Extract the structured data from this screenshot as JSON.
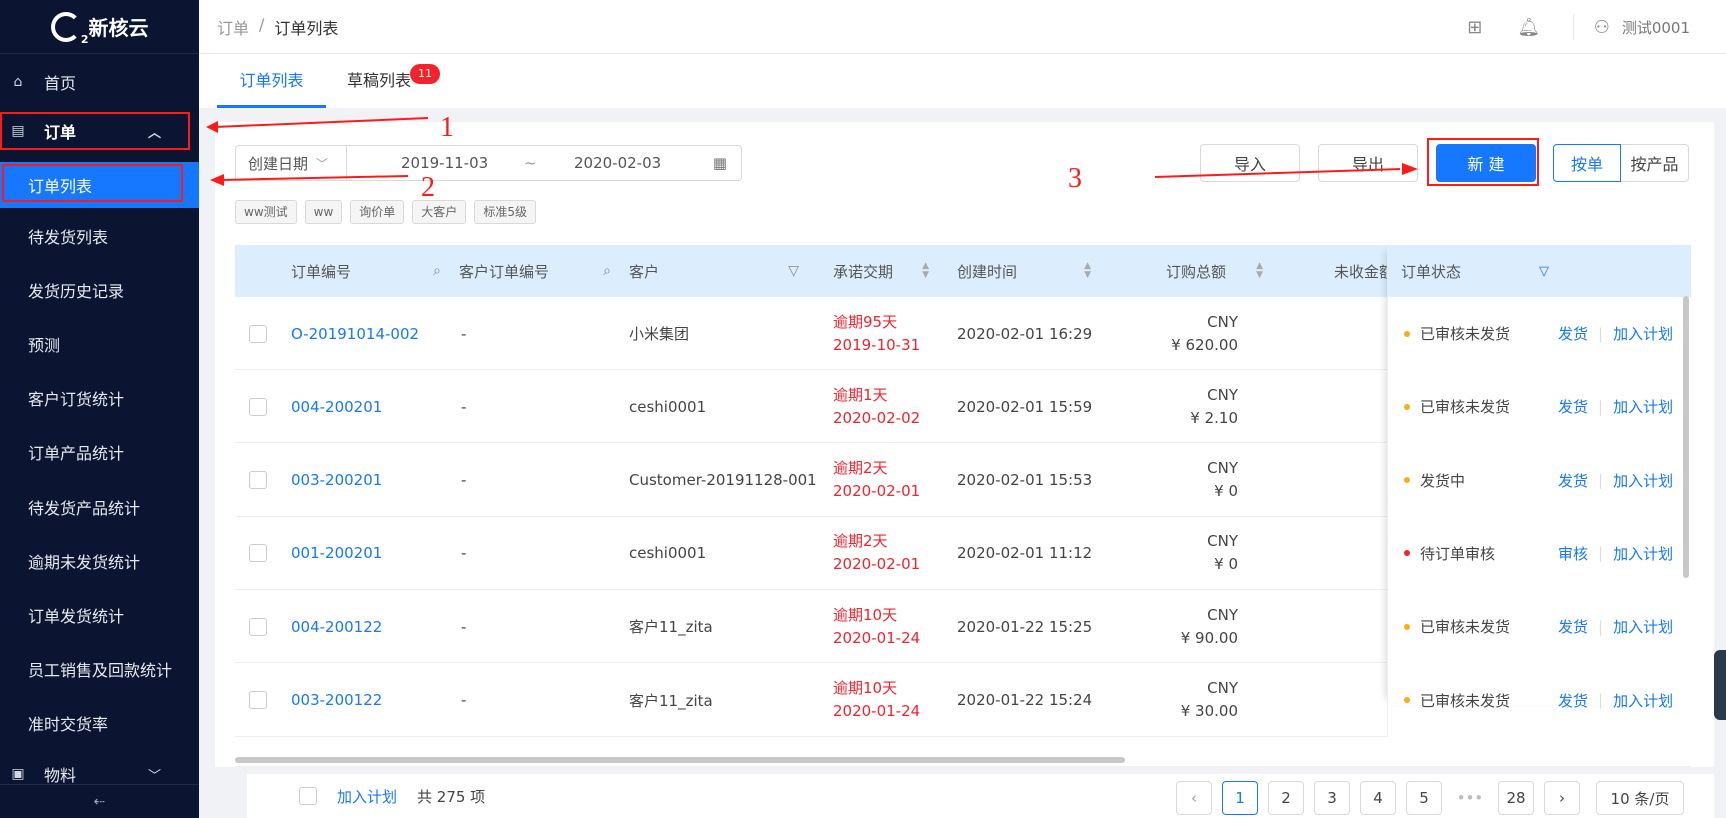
{
  "app": {
    "name": "新核云"
  },
  "sidebar": {
    "home": "首页",
    "order_group": "订单",
    "items": [
      {
        "label": "订单列表"
      },
      {
        "label": "待发货列表"
      },
      {
        "label": "发货历史记录"
      },
      {
        "label": "预测"
      },
      {
        "label": "客户订货统计"
      },
      {
        "label": "订单产品统计"
      },
      {
        "label": "待发货产品统计"
      },
      {
        "label": "逾期未发货统计"
      },
      {
        "label": "订单发货统计"
      },
      {
        "label": "员工销售及回款统计"
      },
      {
        "label": "准时交货率"
      }
    ],
    "material_group": "物料",
    "collapse": "⇠"
  },
  "header": {
    "breadcrumb": [
      "订单",
      "/",
      "订单列表"
    ],
    "user": "测试0001"
  },
  "tabs": [
    {
      "label": "订单列表"
    },
    {
      "label": "草稿列表",
      "badge": "11"
    }
  ],
  "filter": {
    "date_type": "创建日期",
    "start": "2019-11-03",
    "sep": "~",
    "end": "2020-02-03",
    "tags": [
      "ww测试",
      "ww",
      "询价单",
      "大客户",
      "标准5级"
    ]
  },
  "toolbar": {
    "import": "导入",
    "export": "导出",
    "create": "新 建",
    "by_order": "按单",
    "by_product": "按产品"
  },
  "table": {
    "headers": {
      "order_no": "订单编号",
      "customer_order_no": "客户订单编号",
      "customer": "客户",
      "promise_date": "承诺交期",
      "created": "创建时间",
      "total": "订购总额",
      "unreceived": "未收金额",
      "status": "订单状态"
    },
    "rows": [
      {
        "order_no": "O-20191014-002",
        "customer_order_no": "-",
        "customer": "小米集团",
        "overdue": "逾期95天",
        "promise_date": "2019-10-31",
        "created": "2020-02-01 16:29",
        "currency": "CNY",
        "amount": "¥ 620.00",
        "status": "已审核未发货",
        "status_color": "#faad14",
        "op1": "发货",
        "op2": "加入计划"
      },
      {
        "order_no": "004-200201",
        "customer_order_no": "-",
        "customer": "ceshi0001",
        "overdue": "逾期1天",
        "promise_date": "2020-02-02",
        "created": "2020-02-01 15:59",
        "currency": "CNY",
        "amount": "¥ 2.10",
        "status": "已审核未发货",
        "status_color": "#faad14",
        "op1": "发货",
        "op2": "加入计划"
      },
      {
        "order_no": "003-200201",
        "customer_order_no": "-",
        "customer": "Customer-20191128-001",
        "overdue": "逾期2天",
        "promise_date": "2020-02-01",
        "created": "2020-02-01 15:53",
        "currency": "CNY",
        "amount": "¥ 0",
        "status": "发货中",
        "status_color": "#faad14",
        "op1": "发货",
        "op2": "加入计划"
      },
      {
        "order_no": "001-200201",
        "customer_order_no": "-",
        "customer": "ceshi0001",
        "overdue": "逾期2天",
        "promise_date": "2020-02-01",
        "created": "2020-02-01 11:12",
        "currency": "CNY",
        "amount": "¥ 0",
        "status": "待订单审核",
        "status_color": "#f5222d",
        "op1": "审核",
        "op2": "加入计划"
      },
      {
        "order_no": "004-200122",
        "customer_order_no": "-",
        "customer": "客户11_zita",
        "overdue": "逾期10天",
        "promise_date": "2020-01-24",
        "created": "2020-01-22 15:25",
        "currency": "CNY",
        "amount": "¥ 90.00",
        "status": "已审核未发货",
        "status_color": "#faad14",
        "op1": "发货",
        "op2": "加入计划"
      },
      {
        "order_no": "003-200122",
        "customer_order_no": "-",
        "customer": "客户11_zita",
        "overdue": "逾期10天",
        "promise_date": "2020-01-24",
        "created": "2020-01-22 15:24",
        "currency": "CNY",
        "amount": "¥ 30.00",
        "status": "已审核未发货",
        "status_color": "#faad14",
        "op1": "发货",
        "op2": "加入计划"
      }
    ]
  },
  "footer": {
    "add_plan": "加入计划",
    "total": "共 275 项",
    "pages": [
      "1",
      "2",
      "3",
      "4",
      "5"
    ],
    "ellipsis": "•••",
    "last_page": "28",
    "page_size": "10 条/页",
    "current_page": "1"
  },
  "annotations": [
    "1",
    "2",
    "3"
  ],
  "colors": {
    "accent": "#1677ff",
    "sidebar_bg": "#0b1531",
    "danger": "#f5222d",
    "warning": "#faad14",
    "annotation": "#ff1a1a"
  }
}
